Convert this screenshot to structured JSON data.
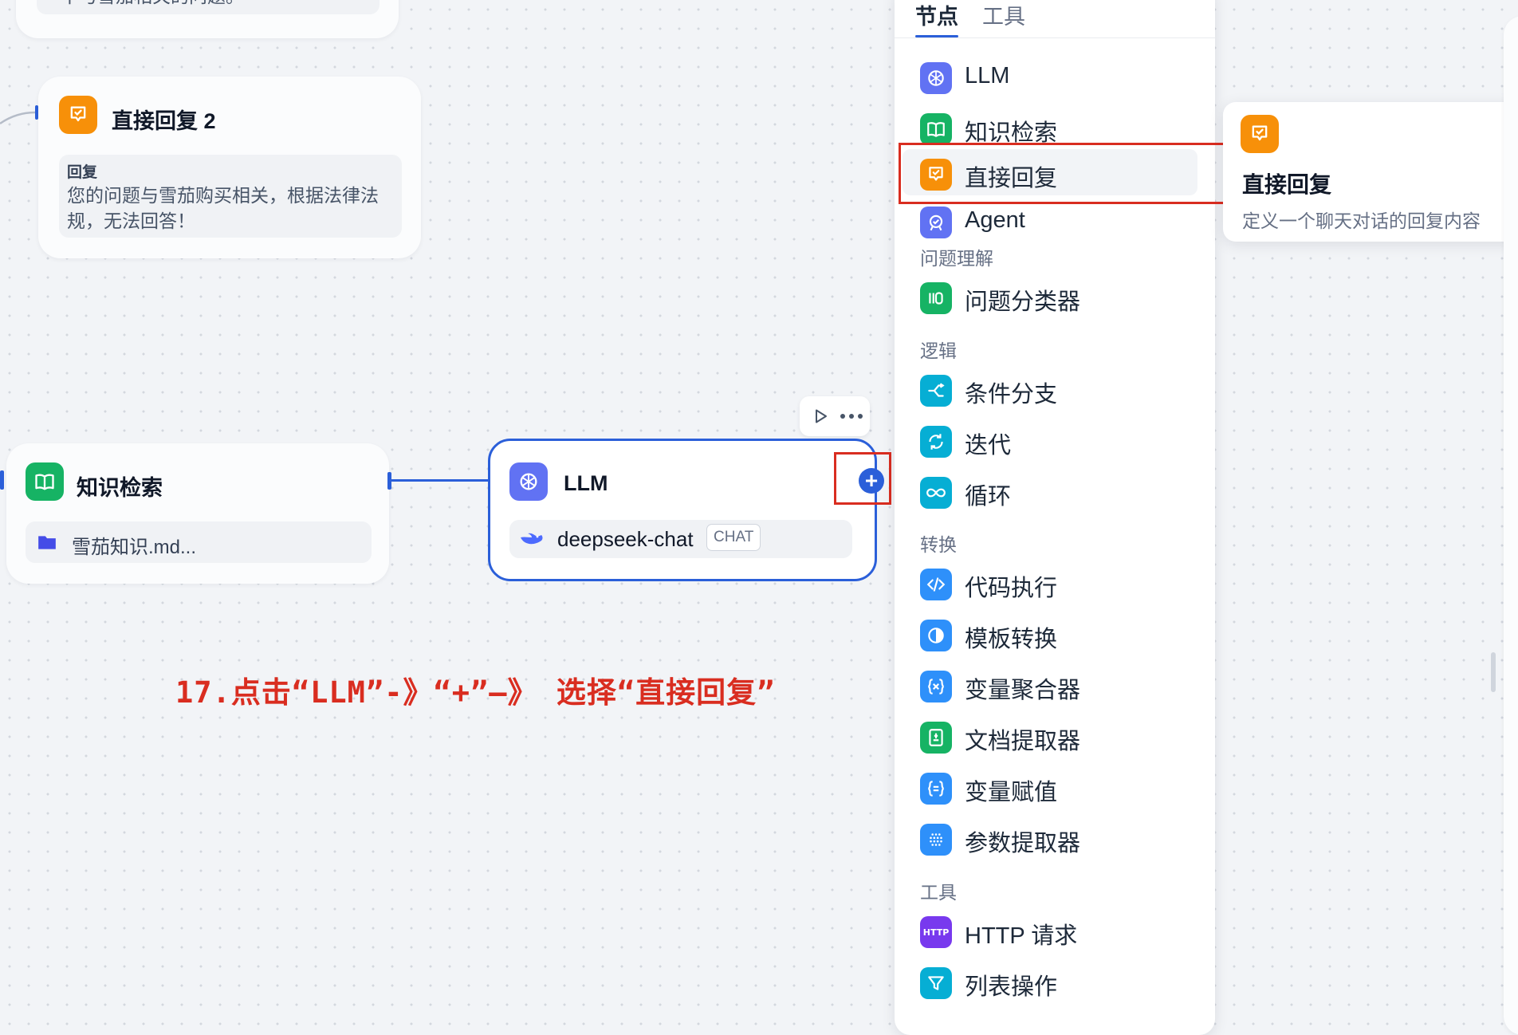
{
  "canvas": {
    "top_partial_node_text": "干与雪茄相关的问题。",
    "reply_node": {
      "title": "直接回复 2",
      "field_label": "回复",
      "field_text_line1": "您的问题与雪茄购买相关，根据法律法",
      "field_text_line2": "规，无法回答！"
    },
    "knowledge_node": {
      "title": "知识检索",
      "file": "雪茄知识.md..."
    },
    "llm_node": {
      "title": "LLM",
      "model": "deepseek-chat",
      "model_tag": "CHAT"
    },
    "instruction": "17.点击“LLM”-》“+”—》 选择“直接回复”"
  },
  "panel": {
    "tabs": [
      {
        "label": "节点",
        "active": true
      },
      {
        "label": "工具",
        "active": false
      }
    ],
    "items": [
      {
        "label": "LLM",
        "icon": "llm-icon",
        "color": "#6172f3"
      },
      {
        "label": "知识检索",
        "icon": "book-icon",
        "color": "#16b364"
      },
      {
        "label": "直接回复",
        "icon": "reply-icon",
        "color": "#f79009"
      },
      {
        "label": "Agent",
        "icon": "agent-icon",
        "color": "#6172f3"
      }
    ],
    "sections": {
      "understanding": {
        "title": "问题理解",
        "items": [
          {
            "label": "问题分类器",
            "icon": "classifier-icon",
            "color": "#16b364"
          }
        ]
      },
      "logic": {
        "title": "逻辑",
        "items": [
          {
            "label": "条件分支",
            "icon": "branch-icon",
            "color": "#06aed4"
          },
          {
            "label": "迭代",
            "icon": "iteration-icon",
            "color": "#06aed4"
          },
          {
            "label": "循环",
            "icon": "loop-icon",
            "color": "#06aed4"
          }
        ]
      },
      "transform": {
        "title": "转换",
        "items": [
          {
            "label": "代码执行",
            "icon": "code-icon",
            "color": "#2e90fa"
          },
          {
            "label": "模板转换",
            "icon": "template-icon",
            "color": "#2e90fa"
          },
          {
            "label": "变量聚合器",
            "icon": "variable-aggregator-icon",
            "color": "#2e90fa"
          },
          {
            "label": "文档提取器",
            "icon": "doc-extractor-icon",
            "color": "#16b364"
          },
          {
            "label": "变量赋值",
            "icon": "variable-assign-icon",
            "color": "#2e90fa"
          },
          {
            "label": "参数提取器",
            "icon": "parameter-extractor-icon",
            "color": "#2e90fa"
          }
        ]
      },
      "tools": {
        "title": "工具",
        "items": [
          {
            "label": "HTTP 请求",
            "icon": "http-icon",
            "color": "#7839ee",
            "icon_text": "HTTP"
          },
          {
            "label": "列表操作",
            "icon": "filter-icon",
            "color": "#06aed4"
          }
        ]
      }
    }
  },
  "tooltip": {
    "title": "直接回复",
    "description": "定义一个聊天对话的回复内容"
  },
  "colors": {
    "accent": "#2b5fd9",
    "highlight_box": "#d92d20",
    "instruction_text": "#d92d20"
  }
}
